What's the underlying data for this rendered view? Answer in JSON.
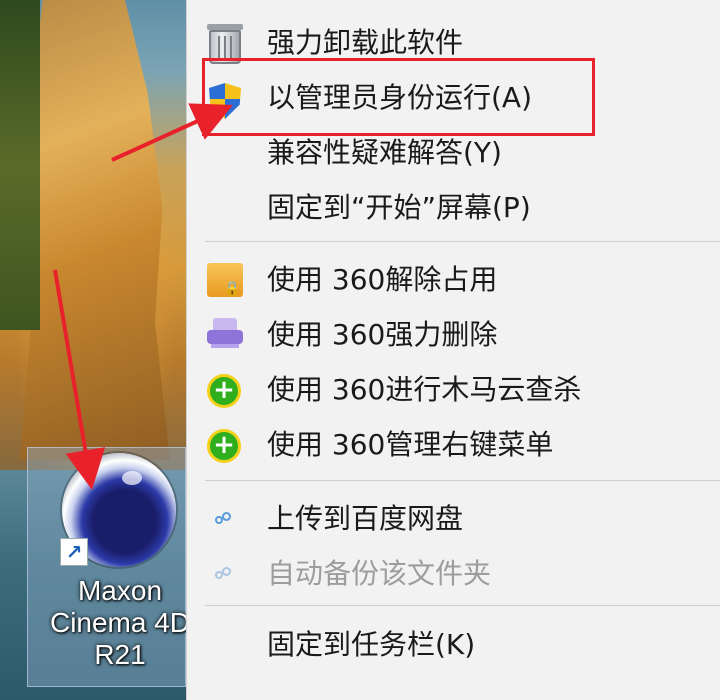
{
  "desktop": {
    "shortcut": {
      "label": "Maxon\nCinema 4D\nR21",
      "icon": "cinema4d-icon"
    }
  },
  "context_menu": {
    "items": [
      {
        "label": "强力卸载此软件",
        "icon": "trash-icon",
        "disabled": false
      },
      {
        "label": "以管理员身份运行(A)",
        "icon": "uac-shield-icon",
        "disabled": false,
        "highlighted": true
      },
      {
        "label": "兼容性疑难解答(Y)",
        "icon": "",
        "disabled": false
      },
      {
        "label": "固定到“开始”屏幕(P)",
        "icon": "",
        "disabled": false
      },
      {
        "label": "使用 360解除占用",
        "icon": "360-unlock-folder-icon",
        "disabled": false
      },
      {
        "label": "使用 360强力删除",
        "icon": "360-shredder-icon",
        "disabled": false
      },
      {
        "label": "使用 360进行木马云查杀",
        "icon": "360-plus-icon",
        "disabled": false
      },
      {
        "label": "使用 360管理右键菜单",
        "icon": "360-plus-icon",
        "disabled": false
      },
      {
        "label": "上传到百度网盘",
        "icon": "baidu-cloud-icon",
        "disabled": false
      },
      {
        "label": "自动备份该文件夹",
        "icon": "baidu-cloud-icon",
        "disabled": true
      },
      {
        "label": "固定到任务栏(K)",
        "icon": "",
        "disabled": false
      }
    ]
  },
  "colors": {
    "annotation": "#e8212b",
    "menu_bg": "#f2f2f2",
    "disabled_text": "#9d9d9d"
  }
}
